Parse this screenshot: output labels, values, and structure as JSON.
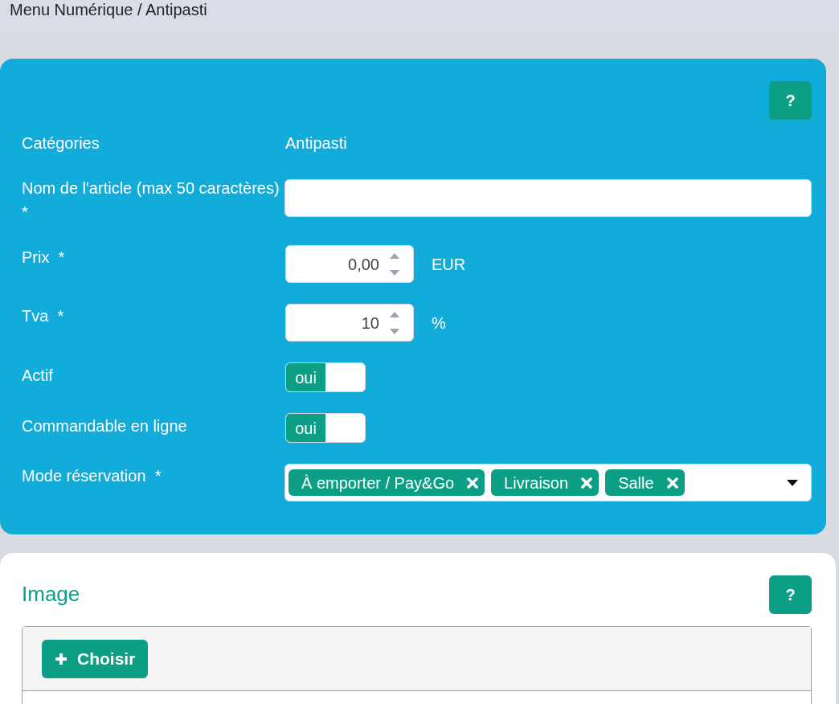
{
  "breadcrumb": "Menu Numérique / Antipasti",
  "form": {
    "help": "?",
    "fields": [
      {
        "kind": "static",
        "label": "Catégories",
        "value": "Antipasti"
      },
      {
        "kind": "text",
        "label": "Nom de l'article (max 50 caractères)  *"
      },
      {
        "kind": "number",
        "label": "Prix  *",
        "value": "0,00",
        "unit": "EUR"
      },
      {
        "kind": "number",
        "label": "Tva  *",
        "value": "10",
        "unit": "%"
      },
      {
        "kind": "toggle",
        "label": "Actif",
        "on": true,
        "on_label": "oui"
      },
      {
        "kind": "toggle",
        "label": "Commandable en ligne",
        "on": true,
        "on_label": "oui"
      },
      {
        "kind": "tags",
        "label": "Mode réservation  *",
        "tags": [
          "À emporter / Pay&Go",
          "Livraison",
          "Salle"
        ]
      }
    ]
  },
  "image_section": {
    "title": "Image",
    "help": "?",
    "button": "Choisir"
  }
}
